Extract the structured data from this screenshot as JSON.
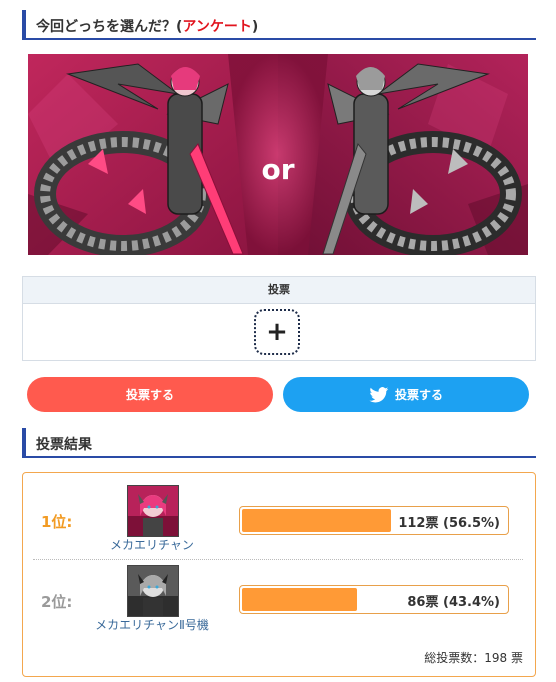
{
  "survey": {
    "title_main": "今回どっちを選んだ？(",
    "title_accent": "アンケート",
    "title_close": ")",
    "banner_or": "or"
  },
  "vote": {
    "header": "投票",
    "plus_symbol": "+",
    "vote_button": "投票する",
    "twitter_button": "投票する"
  },
  "results": {
    "heading": "投票結果",
    "items": [
      {
        "rank": "1位:",
        "name": "メカエリチャン",
        "votes_text": "112票 (56.5%)",
        "percent": 56.5
      },
      {
        "rank": "2位:",
        "name": "メカエリチャンⅡ号機",
        "votes_text": "86票 (43.4%)",
        "percent": 43.4
      }
    ],
    "total": "総投票数：198 票"
  },
  "colors": {
    "accent_blue": "#2a4ba6",
    "accent_red": "#e1141e",
    "vote_button": "#ff5a4e",
    "twitter": "#1da1f2",
    "bar_fill": "#ff9a36",
    "rank_first": "#f29b23",
    "rank_second": "#9a9a9a"
  }
}
